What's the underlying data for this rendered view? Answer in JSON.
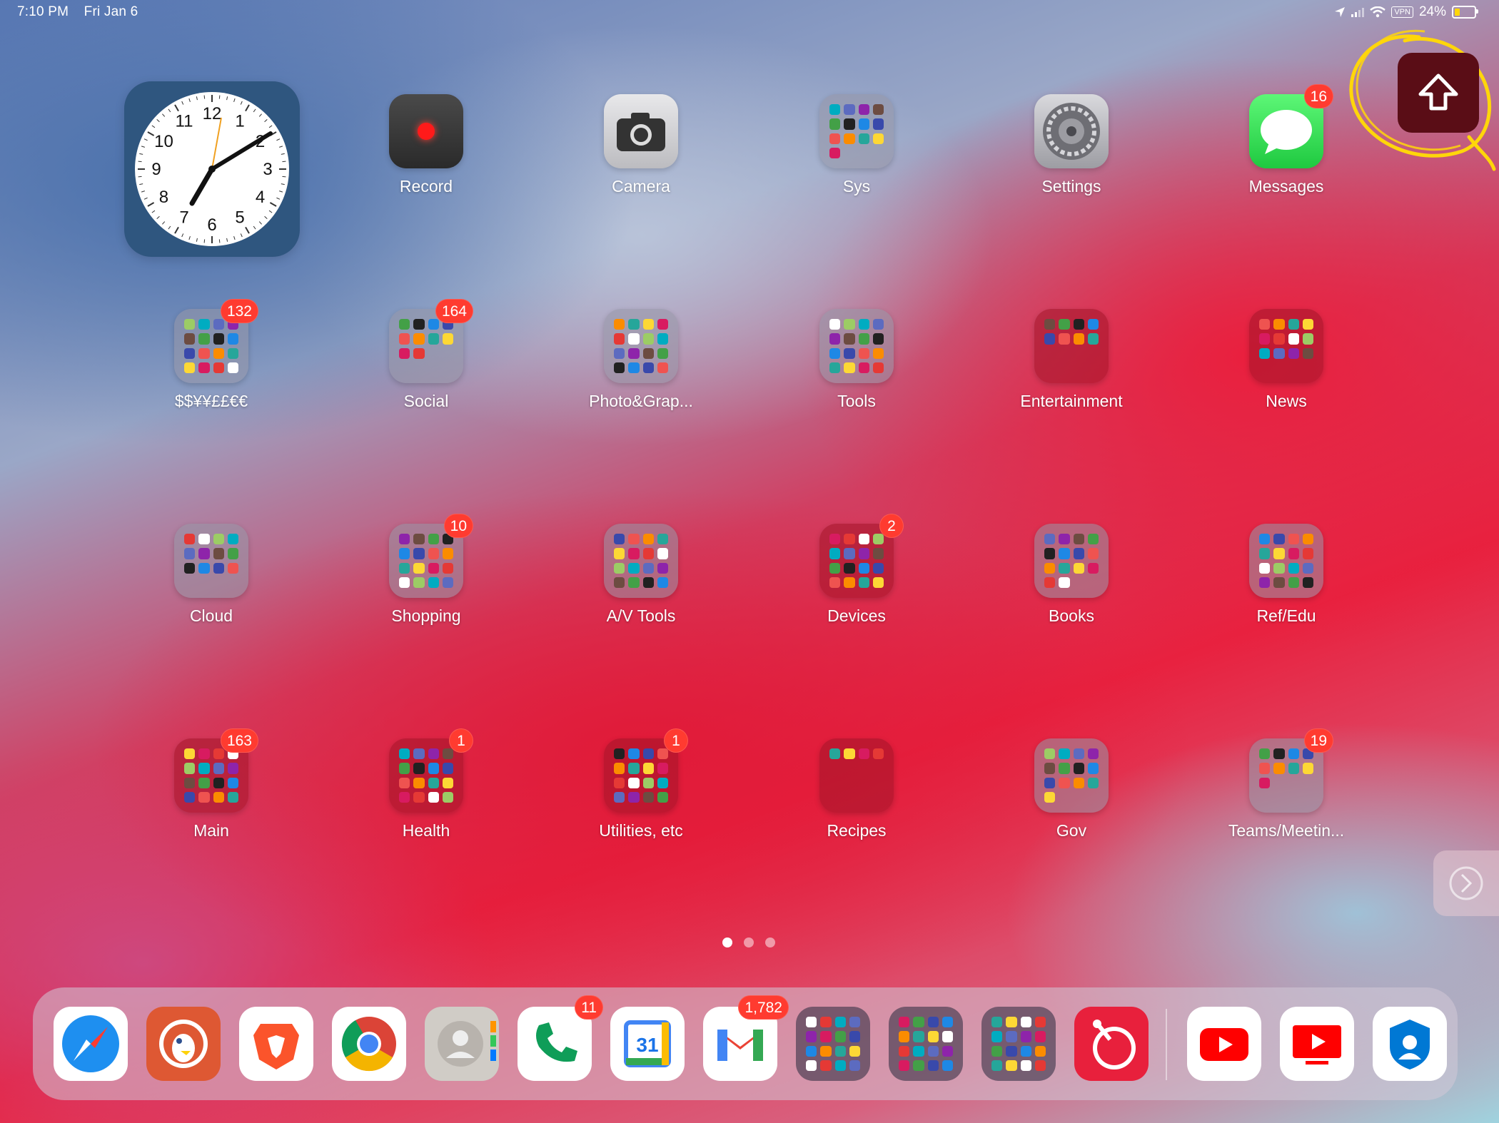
{
  "status_bar": {
    "time": "7:10 PM",
    "date": "Fri Jan 6",
    "vpn": "VPN",
    "battery": "24%"
  },
  "clock": {
    "numbers": [
      "12",
      "1",
      "2",
      "3",
      "4",
      "5",
      "6",
      "7",
      "8",
      "9",
      "10",
      "11"
    ]
  },
  "apps": [
    {
      "name": "Record"
    },
    {
      "name": "Camera"
    },
    {
      "name": "Sys"
    },
    {
      "name": "Settings"
    },
    {
      "name": "Messages",
      "badge": "16"
    },
    {
      "name": "$$¥¥££€€",
      "badge": "132"
    },
    {
      "name": "Social",
      "badge": "164"
    },
    {
      "name": "Photo&Grap..."
    },
    {
      "name": "Tools"
    },
    {
      "name": "Entertainment"
    },
    {
      "name": "News"
    },
    {
      "name": "Cloud"
    },
    {
      "name": "Shopping",
      "badge": "10"
    },
    {
      "name": "A/V Tools"
    },
    {
      "name": "Devices",
      "badge": "2"
    },
    {
      "name": "Books"
    },
    {
      "name": "Ref/Edu"
    },
    {
      "name": "Main",
      "badge": "163"
    },
    {
      "name": "Health",
      "badge": "1"
    },
    {
      "name": "Utilities, etc",
      "badge": "1"
    },
    {
      "name": "Recipes"
    },
    {
      "name": "Gov"
    },
    {
      "name": "Teams/Meetin...",
      "badge": "19"
    }
  ],
  "dock": [
    {
      "icon": "safari-icon"
    },
    {
      "icon": "duckduckgo-icon"
    },
    {
      "icon": "brave-icon"
    },
    {
      "icon": "chrome-icon"
    },
    {
      "icon": "contacts-icon"
    },
    {
      "icon": "phone-icon",
      "badge": "11"
    },
    {
      "icon": "calendar-icon",
      "text": "31"
    },
    {
      "icon": "gmail-icon",
      "badge": "1,782"
    },
    {
      "icon": "folder-icon"
    },
    {
      "icon": "folder-icon"
    },
    {
      "icon": "folder-icon"
    },
    {
      "icon": "fetch-icon"
    },
    {
      "icon": "youtube-icon"
    },
    {
      "icon": "youtube-tv-icon"
    },
    {
      "icon": "authenticator-icon"
    }
  ],
  "colors": {
    "badge": "#ff3b30",
    "scribble": "#ffd60a",
    "messages": "#34c759"
  }
}
